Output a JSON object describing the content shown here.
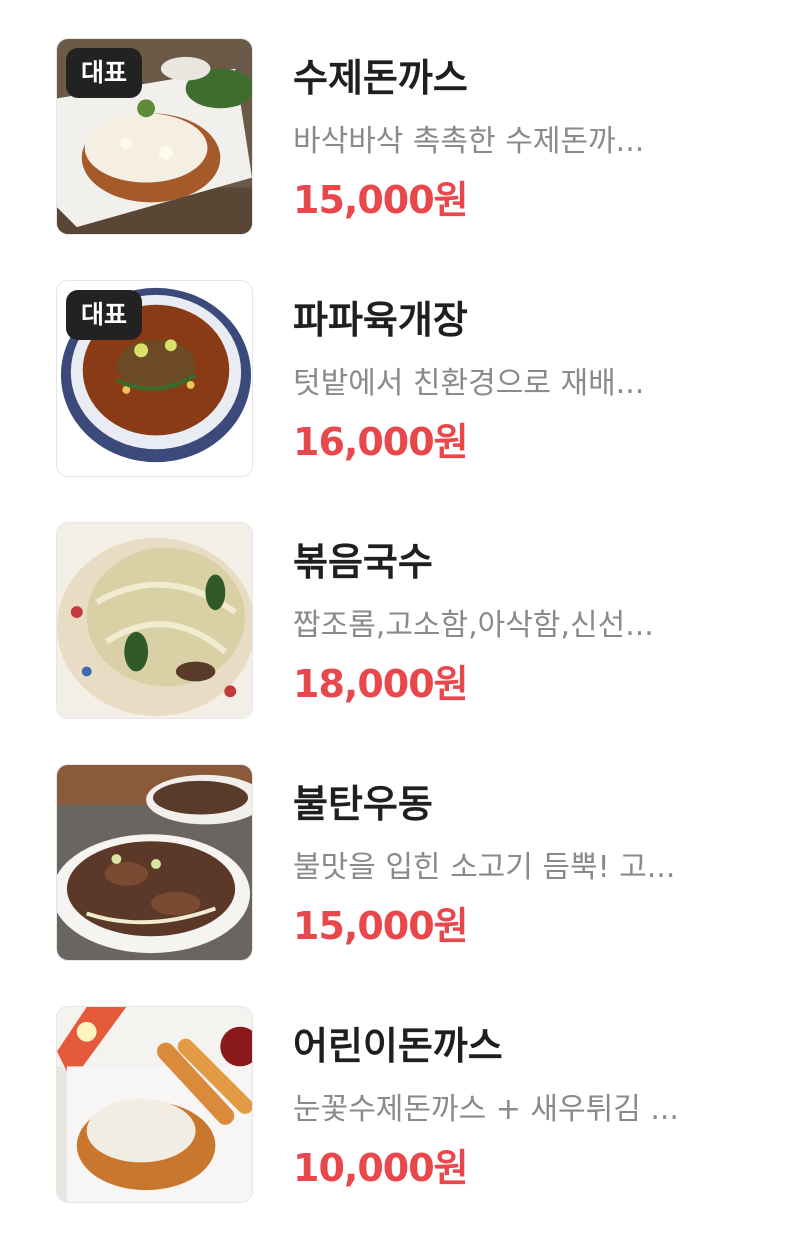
{
  "menu": {
    "items": [
      {
        "name": "수제돈까스",
        "description": "바삭바삭 촉촉한 수제돈까...",
        "price": "15,000원",
        "badge": "대표",
        "image_icon": "tonkatsu-photo"
      },
      {
        "name": "파파육개장",
        "description": "텃밭에서 친환경으로 재배...",
        "price": "16,000원",
        "badge": "대표",
        "image_icon": "yukgaejang-photo"
      },
      {
        "name": "볶음국수",
        "description": "짭조롬,고소함,아삭함,신선...",
        "price": "18,000원",
        "image_icon": "stir-fried-noodles-photo"
      },
      {
        "name": "불탄우동",
        "description": "불맛을 입힌 소고기 듬뿍! 고...",
        "price": "15,000원",
        "image_icon": "udon-photo"
      },
      {
        "name": "어린이돈까스",
        "description": "눈꽃수제돈까스 + 새우튀김 ...",
        "price": "10,000원",
        "image_icon": "kids-tonkatsu-photo"
      }
    ]
  },
  "colors": {
    "price": "#e8474b",
    "name": "#1f1f1f",
    "description": "#8a8a8a",
    "badge_bg": "#222222"
  }
}
